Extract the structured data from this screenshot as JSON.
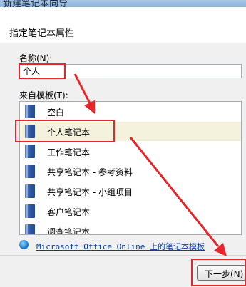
{
  "window": {
    "title": "新建笔记本向导"
  },
  "header": {
    "heading": "指定笔记本属性"
  },
  "name_field": {
    "label": "名称(N):",
    "value": "个人"
  },
  "template_list": {
    "label": "来自模板(T):",
    "items": [
      {
        "label": "空白",
        "icon": "notebook-icon"
      },
      {
        "label": "个人笔记本",
        "icon": "notebook-icon",
        "selected": true
      },
      {
        "label": "工作笔记本",
        "icon": "notebook-icon"
      },
      {
        "label": "共享笔记本 - 参考资料",
        "icon": "notebook-icon"
      },
      {
        "label": "共享笔记本 - 小组项目",
        "icon": "notebook-icon"
      },
      {
        "label": "客户笔记本",
        "icon": "notebook-icon"
      },
      {
        "label": "调查笔记本",
        "icon": "notebook-icon"
      }
    ]
  },
  "online_link": {
    "icon": "globe-icon",
    "text": "Microsoft Office Online 上的笔记本模板"
  },
  "footer": {
    "next_label": "下一步(N)"
  },
  "annotation": {
    "color": "#e8262a"
  }
}
